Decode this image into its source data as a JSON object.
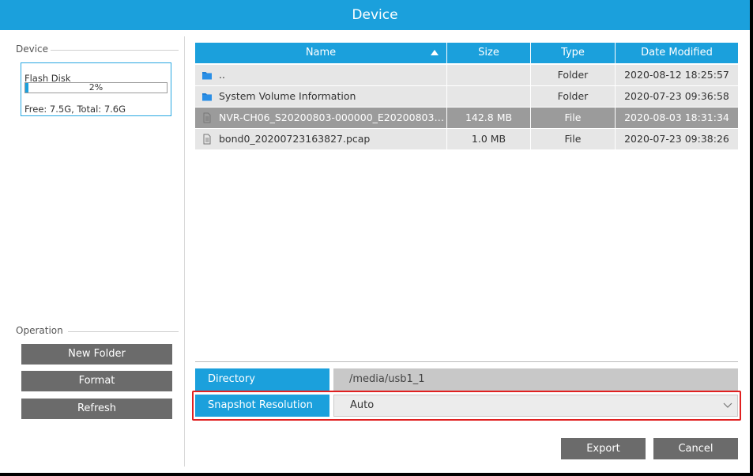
{
  "dialog": {
    "title": "Device"
  },
  "device_section": {
    "label": "Device",
    "disk": {
      "name": "Flash Disk",
      "usage_percent_text": "2%",
      "usage_fraction": 0.02,
      "free_total": "Free: 7.5G, Total: 7.6G"
    }
  },
  "operation_section": {
    "label": "Operation",
    "buttons": [
      "New Folder",
      "Format",
      "Refresh"
    ]
  },
  "table": {
    "columns": [
      "Name",
      "Size",
      "Type",
      "Date Modified"
    ],
    "sort": {
      "column": "Name",
      "direction": "ascending"
    },
    "rows": [
      {
        "icon": "folder-icon",
        "name": "..",
        "size": "",
        "type": "Folder",
        "date": "2020-08-12 18:25:57",
        "state": "normal"
      },
      {
        "icon": "folder-icon",
        "name": "System Volume Information",
        "size": "",
        "type": "Folder",
        "date": "2020-07-23 09:36:58",
        "state": "normal"
      },
      {
        "icon": "file-icon",
        "name": "NVR-CH06_S20200803-000000_E20200803-00...",
        "size": "142.8 MB",
        "type": "File",
        "date": "2020-08-03 18:31:34",
        "state": "selected"
      },
      {
        "icon": "file-icon",
        "name": "bond0_20200723163827.pcap",
        "size": "1.0 MB",
        "type": "File",
        "date": "2020-07-23 09:38:26",
        "state": "normal"
      }
    ]
  },
  "directory": {
    "label": "Directory",
    "value": "/media/usb1_1"
  },
  "snapshot": {
    "label": "Snapshot Resolution",
    "value": "Auto"
  },
  "actions": {
    "export": "Export",
    "cancel": "Cancel"
  },
  "colors": {
    "accent": "#1ba0dc",
    "button": "#6b6b6b",
    "row_normal": "#e6e6e6",
    "row_selected": "#9b9b9b",
    "highlight_border": "#e02020"
  }
}
